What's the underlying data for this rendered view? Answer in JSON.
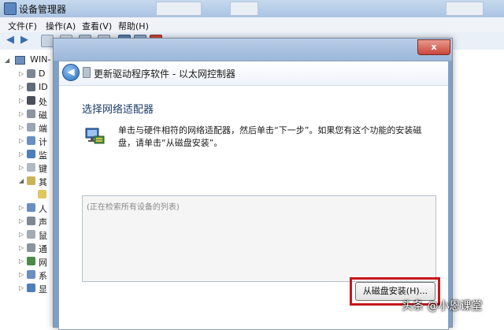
{
  "device_manager": {
    "title": "设备管理器",
    "menu": [
      "文件(F)",
      "操作(A)",
      "查看(V)",
      "帮助(H)"
    ],
    "tree_root": "WIN-",
    "tree_items": [
      "D",
      "ID",
      "处",
      "磁",
      "端",
      "计",
      "监",
      "键",
      "其",
      "",
      "人",
      "声",
      "鼠",
      "通",
      "网",
      "系",
      "显"
    ]
  },
  "wizard": {
    "nav_title": "更新驱动程序软件 - 以太网控制器",
    "close_label": "x",
    "back_label": "◀",
    "heading": "选择网络适配器",
    "description": "单击与硬件相符的网络适配器，然后单击“下一步”。如果您有这个功能的安装磁盘，请单击“从磁盘安装”。",
    "device_list_placeholder": "(正在检索所有设备的列表)",
    "disk_button_label": "从磁盘安装(H)..."
  },
  "watermark": "头条 @小恩课堂",
  "colors": {
    "highlight": "#c8161c",
    "title_bar": "#aac4e2",
    "heading": "#1b3a66"
  }
}
